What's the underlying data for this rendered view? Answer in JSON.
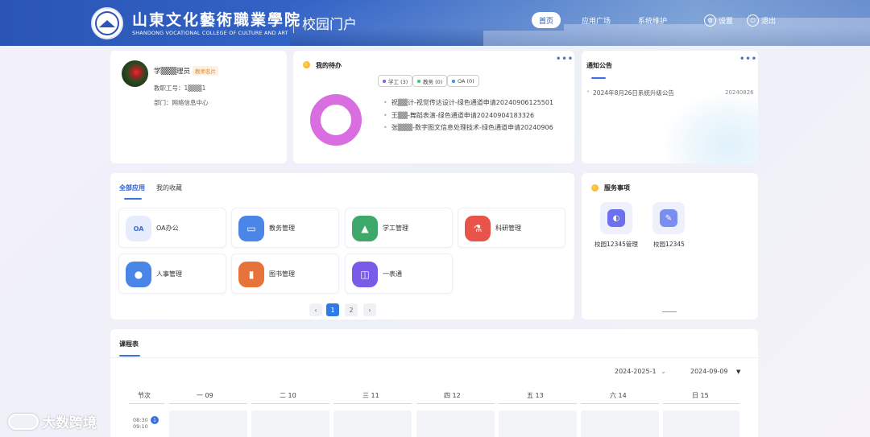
{
  "header": {
    "school_cn": "山東文化藝術職業學院",
    "school_en": "SHANDONG VOCATIONAL COLLEGE OF CULTURE AND ART",
    "portal_title": "校园门户",
    "nav": [
      "首页",
      "应用广场",
      "系统维护"
    ],
    "settings_label": "设置",
    "logout_label": "退出"
  },
  "profile": {
    "name": "学▒▒▒理员",
    "badge": "教师名片",
    "staff_id": "教职工号：1▒▒▒1",
    "department": "部门：网络信息中心"
  },
  "todo": {
    "title": "我的待办",
    "more": "•••",
    "tags": [
      {
        "label": "学工 (3)",
        "color": "#8a56e8"
      },
      {
        "label": "教务 (0)",
        "color": "#3cc36a"
      },
      {
        "label": "OA (0)",
        "color": "#3b8ef0"
      }
    ],
    "items": [
      "祝▒▒计-视觉传达设计-绿色通道申请20240906125501",
      "王▒▒-舞蹈表演-绿色通道申请20240904183326",
      "张▒▒▒-数字图文信息处理技术-绿色通道申请20240906"
    ],
    "donut_color": "#d96ee0"
  },
  "notice": {
    "title": "通知公告",
    "more": "•••",
    "items": [
      {
        "text": "2024年8月26日系统升级公告",
        "date": "20240826"
      }
    ]
  },
  "apps": {
    "tabs": [
      "全部应用",
      "我的收藏"
    ],
    "items": [
      {
        "label": "OA办公",
        "icon": "oa-icon",
        "color": "#e6ecfb"
      },
      {
        "label": "教务管理",
        "icon": "academic-icon",
        "color": "#4a86e8"
      },
      {
        "label": "学工管理",
        "icon": "student-affairs-icon",
        "color": "#3ea86b"
      },
      {
        "label": "科研管理",
        "icon": "research-icon",
        "color": "#e8534a"
      },
      {
        "label": "人事管理",
        "icon": "personnel-icon",
        "color": "#4a86e8"
      },
      {
        "label": "图书管理",
        "icon": "library-icon",
        "color": "#e8733a"
      },
      {
        "label": "一表通",
        "icon": "map-icon",
        "color": "#7a5ae8"
      }
    ],
    "pages": [
      "1",
      "2"
    ],
    "prev": "‹",
    "next": "›"
  },
  "service": {
    "title": "服务事项",
    "items": [
      {
        "label": "校园12345管理",
        "color": "#6b6ff0"
      },
      {
        "label": "校园12345",
        "color": "#7a8ef0"
      }
    ]
  },
  "schedule": {
    "title": "课程表",
    "term": "2024-2025-1",
    "date": "2024-09-09",
    "period_header": "节次",
    "days": [
      "一 09",
      "二 10",
      "三 11",
      "四 12",
      "五 13",
      "六 14",
      "日 15"
    ],
    "first_period": {
      "time_start": "08:30",
      "time_end": "09:10",
      "number": "1"
    }
  },
  "watermark": "大数跨境"
}
